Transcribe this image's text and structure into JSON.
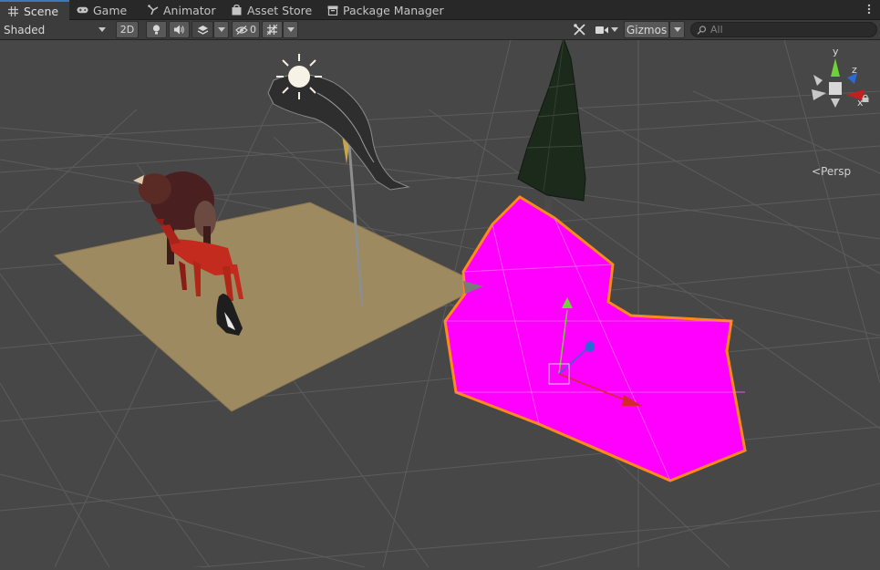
{
  "tabs": [
    {
      "label": "Scene",
      "icon": "grid-icon",
      "active": true
    },
    {
      "label": "Game",
      "icon": "gamepad-icon",
      "active": false
    },
    {
      "label": "Animator",
      "icon": "animator-icon",
      "active": false
    },
    {
      "label": "Asset Store",
      "icon": "shopping-bag-icon",
      "active": false
    },
    {
      "label": "Package Manager",
      "icon": "package-icon",
      "active": false
    }
  ],
  "toolbar": {
    "draw_mode": "Shaded",
    "mode_2d": "2D",
    "hidden_count": "0",
    "gizmos_label": "Gizmos",
    "search_placeholder": "All"
  },
  "scene_gizmo": {
    "projection_label": "Persp",
    "axis_y": "y",
    "axis_z": "z",
    "axis_x": "x"
  },
  "colors": {
    "selection_outline": "#ff8a1c",
    "selected_mesh": "#ff00ff",
    "ground_plane": "#9e8a60",
    "axis_x": "#d42a2a",
    "axis_y": "#6fd23a",
    "axis_z": "#2a6ad4",
    "tab_accent": "#3a79bb"
  }
}
